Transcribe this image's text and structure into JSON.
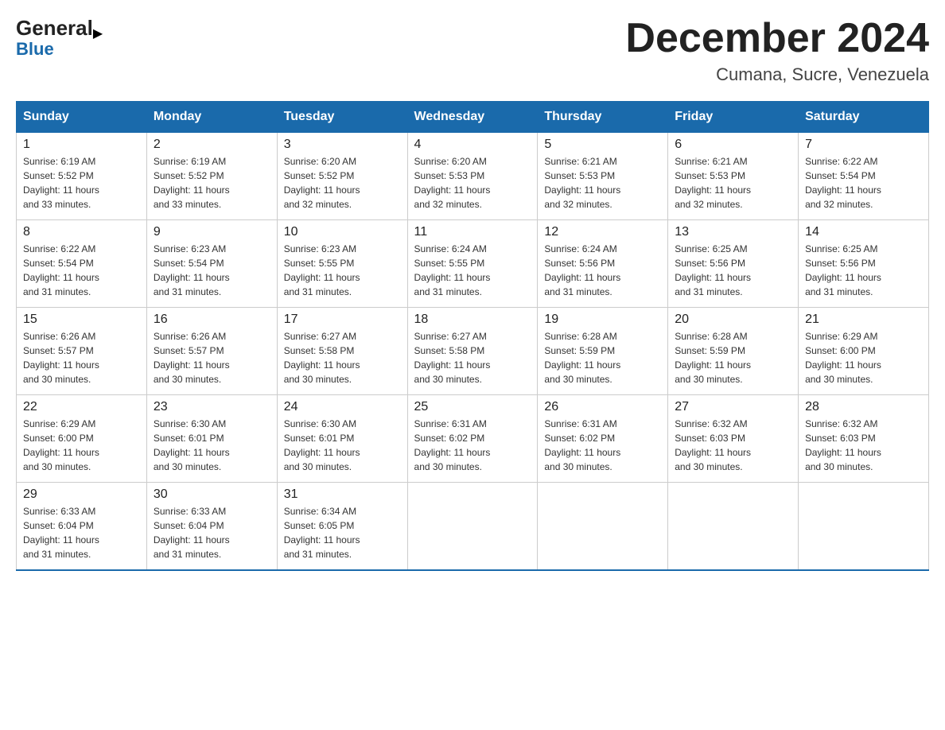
{
  "logo": {
    "general": "General",
    "blue": "Blue"
  },
  "header": {
    "month": "December 2024",
    "location": "Cumana, Sucre, Venezuela"
  },
  "days_of_week": [
    "Sunday",
    "Monday",
    "Tuesday",
    "Wednesday",
    "Thursday",
    "Friday",
    "Saturday"
  ],
  "weeks": [
    [
      {
        "day": "1",
        "sunrise": "6:19 AM",
        "sunset": "5:52 PM",
        "daylight": "11 hours and 33 minutes."
      },
      {
        "day": "2",
        "sunrise": "6:19 AM",
        "sunset": "5:52 PM",
        "daylight": "11 hours and 33 minutes."
      },
      {
        "day": "3",
        "sunrise": "6:20 AM",
        "sunset": "5:52 PM",
        "daylight": "11 hours and 32 minutes."
      },
      {
        "day": "4",
        "sunrise": "6:20 AM",
        "sunset": "5:53 PM",
        "daylight": "11 hours and 32 minutes."
      },
      {
        "day": "5",
        "sunrise": "6:21 AM",
        "sunset": "5:53 PM",
        "daylight": "11 hours and 32 minutes."
      },
      {
        "day": "6",
        "sunrise": "6:21 AM",
        "sunset": "5:53 PM",
        "daylight": "11 hours and 32 minutes."
      },
      {
        "day": "7",
        "sunrise": "6:22 AM",
        "sunset": "5:54 PM",
        "daylight": "11 hours and 32 minutes."
      }
    ],
    [
      {
        "day": "8",
        "sunrise": "6:22 AM",
        "sunset": "5:54 PM",
        "daylight": "11 hours and 31 minutes."
      },
      {
        "day": "9",
        "sunrise": "6:23 AM",
        "sunset": "5:54 PM",
        "daylight": "11 hours and 31 minutes."
      },
      {
        "day": "10",
        "sunrise": "6:23 AM",
        "sunset": "5:55 PM",
        "daylight": "11 hours and 31 minutes."
      },
      {
        "day": "11",
        "sunrise": "6:24 AM",
        "sunset": "5:55 PM",
        "daylight": "11 hours and 31 minutes."
      },
      {
        "day": "12",
        "sunrise": "6:24 AM",
        "sunset": "5:56 PM",
        "daylight": "11 hours and 31 minutes."
      },
      {
        "day": "13",
        "sunrise": "6:25 AM",
        "sunset": "5:56 PM",
        "daylight": "11 hours and 31 minutes."
      },
      {
        "day": "14",
        "sunrise": "6:25 AM",
        "sunset": "5:56 PM",
        "daylight": "11 hours and 31 minutes."
      }
    ],
    [
      {
        "day": "15",
        "sunrise": "6:26 AM",
        "sunset": "5:57 PM",
        "daylight": "11 hours and 30 minutes."
      },
      {
        "day": "16",
        "sunrise": "6:26 AM",
        "sunset": "5:57 PM",
        "daylight": "11 hours and 30 minutes."
      },
      {
        "day": "17",
        "sunrise": "6:27 AM",
        "sunset": "5:58 PM",
        "daylight": "11 hours and 30 minutes."
      },
      {
        "day": "18",
        "sunrise": "6:27 AM",
        "sunset": "5:58 PM",
        "daylight": "11 hours and 30 minutes."
      },
      {
        "day": "19",
        "sunrise": "6:28 AM",
        "sunset": "5:59 PM",
        "daylight": "11 hours and 30 minutes."
      },
      {
        "day": "20",
        "sunrise": "6:28 AM",
        "sunset": "5:59 PM",
        "daylight": "11 hours and 30 minutes."
      },
      {
        "day": "21",
        "sunrise": "6:29 AM",
        "sunset": "6:00 PM",
        "daylight": "11 hours and 30 minutes."
      }
    ],
    [
      {
        "day": "22",
        "sunrise": "6:29 AM",
        "sunset": "6:00 PM",
        "daylight": "11 hours and 30 minutes."
      },
      {
        "day": "23",
        "sunrise": "6:30 AM",
        "sunset": "6:01 PM",
        "daylight": "11 hours and 30 minutes."
      },
      {
        "day": "24",
        "sunrise": "6:30 AM",
        "sunset": "6:01 PM",
        "daylight": "11 hours and 30 minutes."
      },
      {
        "day": "25",
        "sunrise": "6:31 AM",
        "sunset": "6:02 PM",
        "daylight": "11 hours and 30 minutes."
      },
      {
        "day": "26",
        "sunrise": "6:31 AM",
        "sunset": "6:02 PM",
        "daylight": "11 hours and 30 minutes."
      },
      {
        "day": "27",
        "sunrise": "6:32 AM",
        "sunset": "6:03 PM",
        "daylight": "11 hours and 30 minutes."
      },
      {
        "day": "28",
        "sunrise": "6:32 AM",
        "sunset": "6:03 PM",
        "daylight": "11 hours and 30 minutes."
      }
    ],
    [
      {
        "day": "29",
        "sunrise": "6:33 AM",
        "sunset": "6:04 PM",
        "daylight": "11 hours and 31 minutes."
      },
      {
        "day": "30",
        "sunrise": "6:33 AM",
        "sunset": "6:04 PM",
        "daylight": "11 hours and 31 minutes."
      },
      {
        "day": "31",
        "sunrise": "6:34 AM",
        "sunset": "6:05 PM",
        "daylight": "11 hours and 31 minutes."
      },
      null,
      null,
      null,
      null
    ]
  ],
  "labels": {
    "sunrise": "Sunrise:",
    "sunset": "Sunset:",
    "daylight": "Daylight:"
  }
}
